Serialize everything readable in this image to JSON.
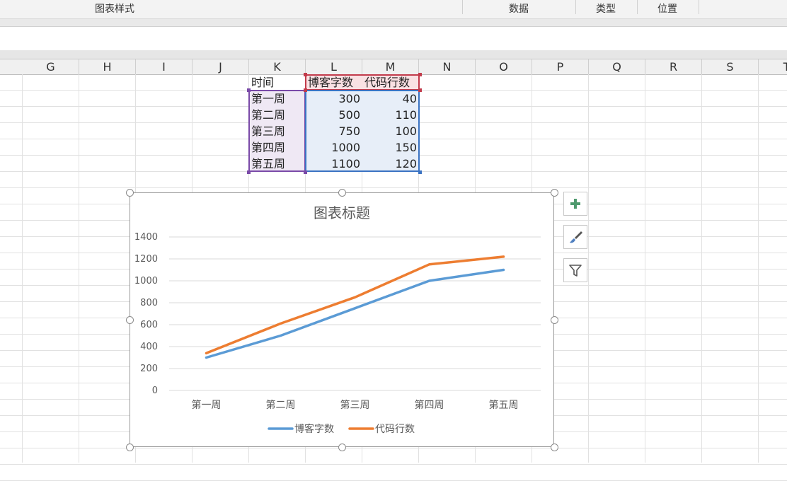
{
  "ribbon": {
    "chart_styles": "图表样式",
    "data": "数据",
    "type": "类型",
    "position": "位置"
  },
  "columns": [
    "G",
    "H",
    "I",
    "J",
    "K",
    "L",
    "M",
    "N",
    "O",
    "P",
    "Q",
    "R",
    "S",
    "T"
  ],
  "table": {
    "header": [
      "时间",
      "博客字数",
      "代码行数"
    ],
    "rows": [
      [
        "第一周",
        "300",
        "40"
      ],
      [
        "第二周",
        "500",
        "110"
      ],
      [
        "第三周",
        "750",
        "100"
      ],
      [
        "第四周",
        "1000",
        "150"
      ],
      [
        "第五周",
        "1100",
        "120"
      ]
    ]
  },
  "colors": {
    "series_blue": "#5b9bd5",
    "series_orange": "#ed7d31",
    "sel_red": "#c23b4b",
    "sel_purple": "#7a4aa8",
    "sel_blue": "#3a72c2"
  },
  "side_buttons": [
    "plus-icon",
    "brush-icon",
    "filter-icon"
  ],
  "chart_data": {
    "type": "line",
    "stacked": true,
    "title": "图表标题",
    "categories": [
      "第一周",
      "第二周",
      "第三周",
      "第四周",
      "第五周"
    ],
    "series": [
      {
        "name": "博客字数",
        "values": [
          300,
          500,
          750,
          1000,
          1100
        ],
        "color": "#5b9bd5"
      },
      {
        "name": "代码行数",
        "values": [
          40,
          110,
          100,
          150,
          120
        ],
        "color": "#ed7d31"
      }
    ],
    "y_ticks": [
      "0",
      "200",
      "400",
      "600",
      "800",
      "1000",
      "1200",
      "1400"
    ],
    "ylim": [
      0,
      1400
    ],
    "grid": true,
    "legend": "bottom"
  }
}
